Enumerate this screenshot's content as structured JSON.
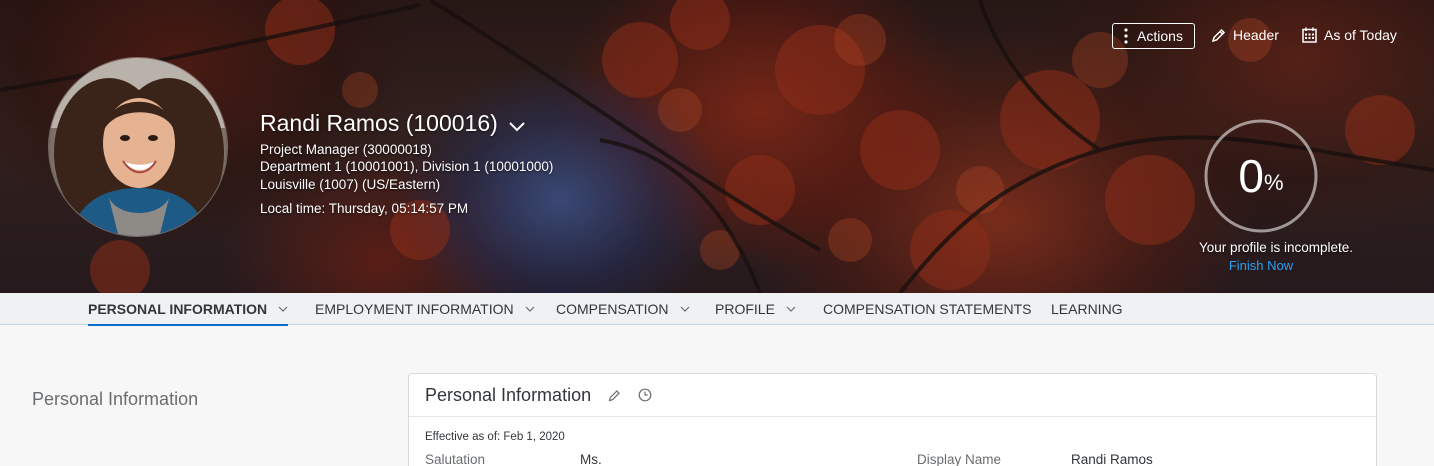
{
  "header": {
    "employee_name": "Randi Ramos (100016)",
    "position": "Project Manager (30000018)",
    "department_division": "Department 1 (10001001), Division 1 (10001000)",
    "location": "Louisville (1007) (US/Eastern)",
    "local_time": "Local time: Thursday, 05:14:57 PM",
    "avatar_icon": "employee-photo"
  },
  "toolbar": {
    "actions_label": "Actions",
    "header_label": "Header",
    "date_label": "As of Today"
  },
  "profile_completion": {
    "percent_value": "0",
    "percent_unit": "%",
    "progress_fraction": 0,
    "message": "Your profile is incomplete.",
    "link_label": "Finish Now"
  },
  "tabs": [
    {
      "label": "PERSONAL INFORMATION",
      "has_menu": true,
      "active": true
    },
    {
      "label": "EMPLOYMENT INFORMATION",
      "has_menu": true,
      "active": false
    },
    {
      "label": "COMPENSATION",
      "has_menu": true,
      "active": false
    },
    {
      "label": "PROFILE",
      "has_menu": true,
      "active": false
    },
    {
      "label": "COMPENSATION STATEMENTS",
      "has_menu": false,
      "active": false
    },
    {
      "label": "LEARNING",
      "has_menu": false,
      "active": false
    }
  ],
  "section": {
    "title": "Personal Information"
  },
  "card": {
    "title": "Personal Information",
    "effective_date": "Effective as of: Feb 1, 2020",
    "fields": [
      {
        "label": "Salutation",
        "value": "Ms."
      },
      {
        "label": "Display Name",
        "value": "Randi Ramos"
      }
    ]
  },
  "colors": {
    "accent": "#0a6ed1",
    "link": "#2a9ff2",
    "tabbar_bg": "#eff1f2",
    "page_bg": "#f7f7f7"
  }
}
